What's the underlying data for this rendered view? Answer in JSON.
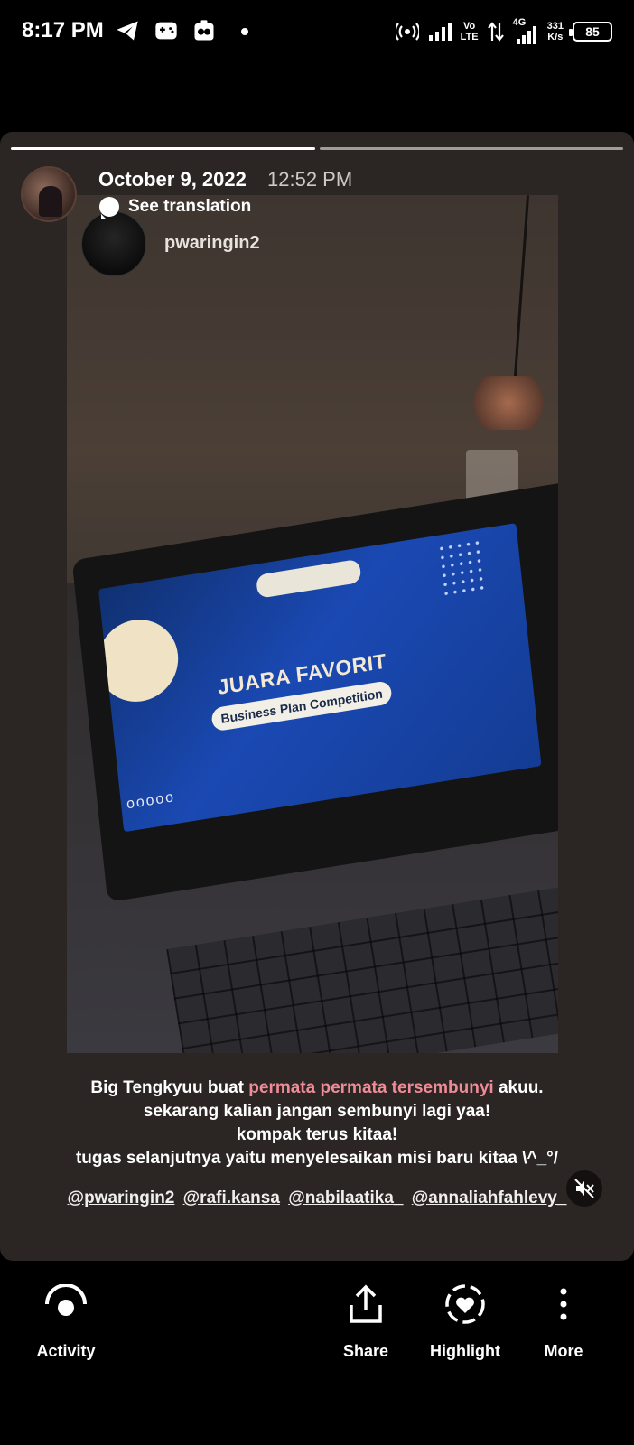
{
  "status_bar": {
    "time": "8:17 PM",
    "net_speed_top": "331",
    "net_speed_bottom": "K/s",
    "volte_top": "Vo",
    "volte_bottom": "LTE",
    "network": "4G",
    "battery": "85"
  },
  "story": {
    "date": "October 9, 2022",
    "time": "12:52 PM",
    "see_translation": "See translation",
    "embedded_username": "pwaringin2",
    "screen_title": "JUARA FAVORIT",
    "screen_subtitle": "Business Plan Competition",
    "screen_circles": "ooooo",
    "caption": {
      "line1_a": "Big Tengkyuu buat ",
      "line1_highlight": "permata permata tersembunyi",
      "line1_b": " akuu.",
      "line2": "sekarang kalian jangan sembunyi lagi yaa!",
      "line3": "kompak terus kitaa!",
      "line4": "tugas selanjutnya yaitu menyelesaikan misi baru kitaa \\^_°/"
    },
    "mentions": [
      "@pwaringin2",
      "@rafi.kansa",
      "@nabilaatika_",
      "@annaliahfahlevy_"
    ],
    "highlight_color": "#ee8b96"
  },
  "bottom_bar": {
    "activity": "Activity",
    "share": "Share",
    "highlight": "Highlight",
    "more": "More"
  }
}
